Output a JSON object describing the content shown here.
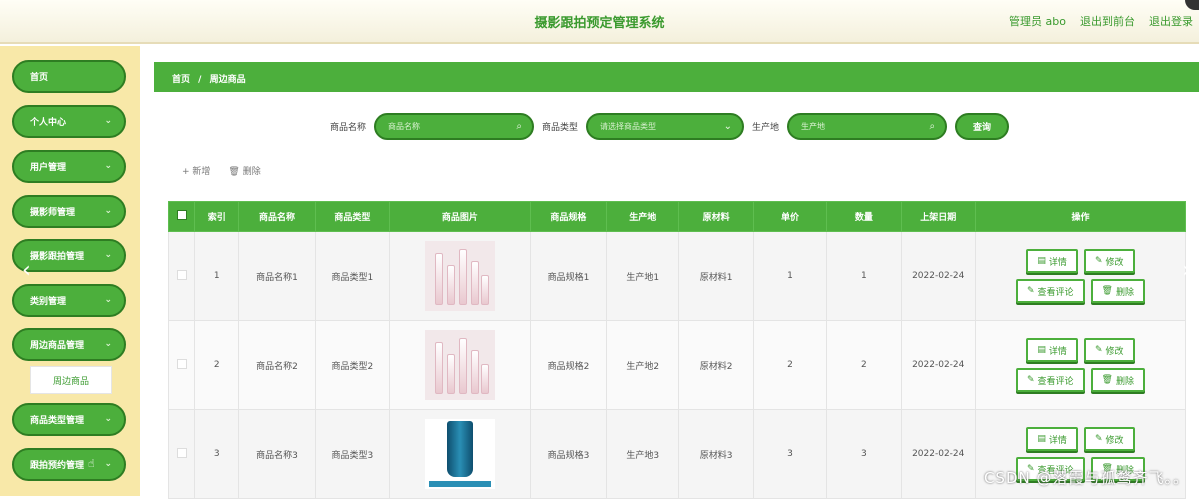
{
  "header": {
    "title": "摄影跟拍预定管理系统",
    "admin": "管理员 abo",
    "exit_front": "退出到前台",
    "logout": "退出登录"
  },
  "sidebar": {
    "items": [
      {
        "label": "首页"
      },
      {
        "label": "个人中心"
      },
      {
        "label": "用户管理"
      },
      {
        "label": "摄影师管理"
      },
      {
        "label": "摄影跟拍管理"
      },
      {
        "label": "类别管理"
      },
      {
        "label": "周边商品管理"
      },
      {
        "label": "商品类型管理"
      },
      {
        "label": "跟拍预约管理"
      }
    ],
    "sub_item": "周边商品"
  },
  "breadcrumb": {
    "home": "首页",
    "sep": "/",
    "current": "周边商品"
  },
  "search": {
    "name_label": "商品名称",
    "name_placeholder": "商品名称",
    "type_label": "商品类型",
    "type_placeholder": "请选择商品类型",
    "origin_label": "生产地",
    "origin_placeholder": "生产地",
    "query_label": "查询"
  },
  "toolbar": {
    "add_label": "+ 新增",
    "delete_label": "删除"
  },
  "table": {
    "headers": [
      "索引",
      "商品名称",
      "商品类型",
      "商品图片",
      "商品规格",
      "生产地",
      "原材料",
      "单价",
      "数量",
      "上架日期",
      "操作"
    ],
    "rows": [
      {
        "index": "1",
        "name": "商品名称1",
        "type": "商品类型1",
        "spec": "商品规格1",
        "origin": "生产地1",
        "material": "原材料1",
        "price": "1",
        "qty": "1",
        "date": "2022-02-24"
      },
      {
        "index": "2",
        "name": "商品名称2",
        "type": "商品类型2",
        "spec": "商品规格2",
        "origin": "生产地2",
        "material": "原材料2",
        "price": "2",
        "qty": "2",
        "date": "2022-02-24"
      },
      {
        "index": "3",
        "name": "商品名称3",
        "type": "商品类型3",
        "spec": "商品规格3",
        "origin": "生产地3",
        "material": "原材料3",
        "price": "3",
        "qty": "3",
        "date": "2022-02-24"
      }
    ],
    "ops": {
      "detail": "详情",
      "edit": "修改",
      "comments": "查看评论",
      "delete": "删除"
    }
  },
  "watermark": "CSDN @落霞与孤鹜齐飞。。",
  "colors": {
    "primary": "#4caf3c",
    "primary_dark": "#2e7d22",
    "sidebar_bg": "#f8e8a8"
  }
}
